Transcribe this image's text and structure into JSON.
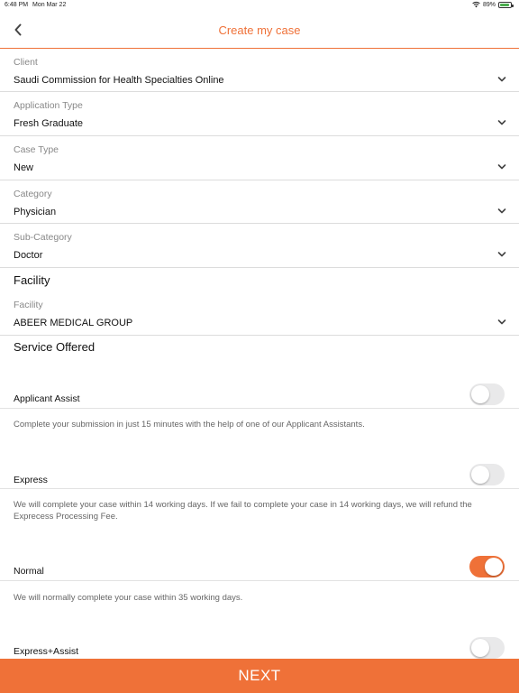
{
  "status_bar": {
    "time": "6:48 PM",
    "date": "Mon Mar 22",
    "battery": "89%"
  },
  "nav": {
    "title": "Create my case"
  },
  "colors": {
    "accent": "#ef7138",
    "toggle_off": "#e9e9ea"
  },
  "fields": [
    {
      "label": "Client",
      "value": "Saudi Commission for Health Specialties Online"
    },
    {
      "label": "Application Type",
      "value": "Fresh Graduate"
    },
    {
      "label": "Case Type",
      "value": "New"
    },
    {
      "label": "Category",
      "value": "Physician"
    },
    {
      "label": "Sub-Category",
      "value": "Doctor"
    }
  ],
  "facility_section": {
    "title": "Facility",
    "field": {
      "label": "Facility",
      "value": "ABEER MEDICAL GROUP"
    }
  },
  "service_section": {
    "title": "Service Offered",
    "services": [
      {
        "label": "Applicant Assist",
        "description": "Complete your submission in just 15 minutes with the help of one of our Applicant Assistants.",
        "enabled": false
      },
      {
        "label": "Express",
        "description": "We will complete your case within 14 working days. If we fail to complete your case in 14 working days, we will refund the Exprecess Processing Fee.",
        "enabled": false
      },
      {
        "label": "Normal",
        "description": "We will normally complete your case within 35 working days.",
        "enabled": true
      },
      {
        "label": "Express+Assist",
        "description": "",
        "enabled": false
      }
    ]
  },
  "footer": {
    "next_label": "NEXT"
  }
}
